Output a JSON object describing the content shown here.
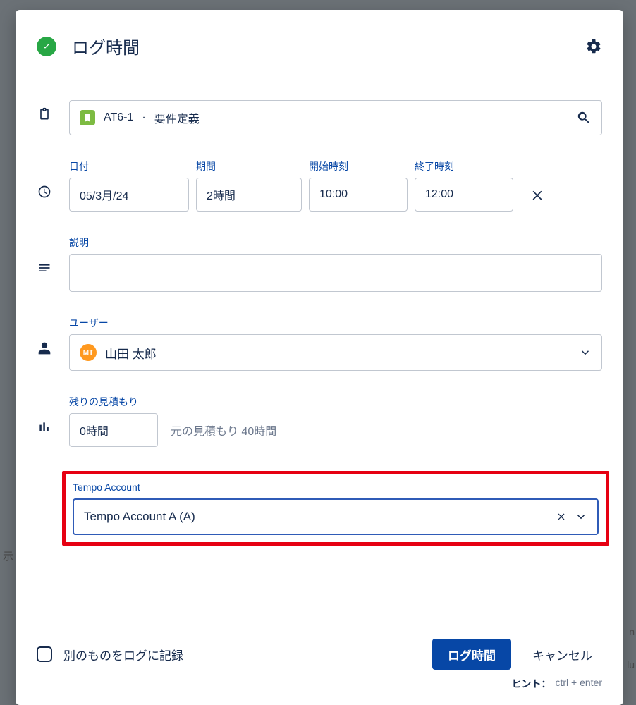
{
  "header": {
    "title": "ログ時間"
  },
  "issue": {
    "key": "AT6-1",
    "separator": "·",
    "summary": "要件定義"
  },
  "fields": {
    "date_label": "日付",
    "date_value": "05/3月/24",
    "duration_label": "期間",
    "duration_value": "2時間",
    "from_label": "開始時刻",
    "from_value": "10:00",
    "to_label": "終了時刻",
    "to_value": "12:00",
    "description_label": "説明",
    "description_value": "",
    "user_label": "ユーザー",
    "user_avatar_initials": "MT",
    "user_name": "山田 太郎",
    "remaining_label": "残りの見積もり",
    "remaining_value": "0時間",
    "original_estimate": "元の見積もり 40時間",
    "tempo_label": "Tempo Account",
    "tempo_value": "Tempo Account A (A)"
  },
  "footer": {
    "checkbox_label": "別のものをログに記録",
    "submit": "ログ時間",
    "cancel": "キャンセル",
    "hint_prefix": "ヒント：",
    "hint_keys": "ctrl + enter"
  },
  "background": {
    "left": "示",
    "r1": "n",
    "r2": "lu"
  }
}
